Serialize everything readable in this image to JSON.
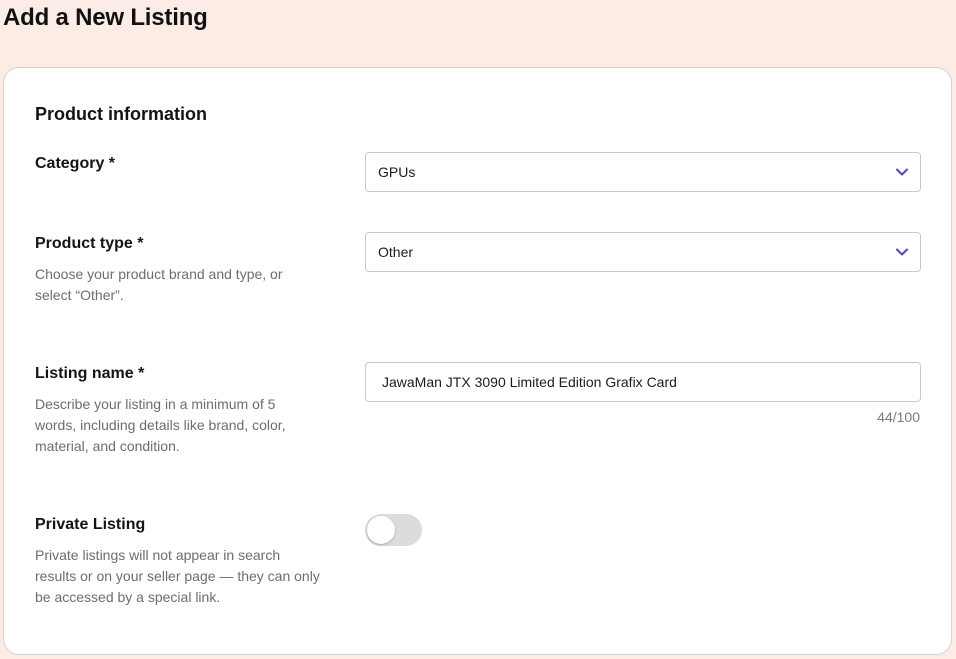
{
  "page": {
    "title": "Add a New Listing"
  },
  "section": {
    "title": "Product information"
  },
  "category": {
    "label": "Category *",
    "value": "GPUs",
    "icon": "chevron-down-icon"
  },
  "product_type": {
    "label": "Product type *",
    "help": "Choose your product brand and type, or select “Other”.",
    "value": "Other",
    "icon": "chevron-down-icon"
  },
  "listing_name": {
    "label": "Listing name *",
    "help": "Describe your listing in a minimum of 5 words, including details like brand, color, material, and condition.",
    "value": "JawaMan JTX 3090 Limited Edition Grafix Card",
    "char_count": "44/100"
  },
  "private_listing": {
    "label": "Private Listing",
    "help": "Private listings will not appear in search results or on your seller page — they can only be accessed by a special link.",
    "enabled": false
  },
  "colors": {
    "background": "#fbede5",
    "accent": "#5b3fd0",
    "toggle_off": "#dcdcdc"
  }
}
